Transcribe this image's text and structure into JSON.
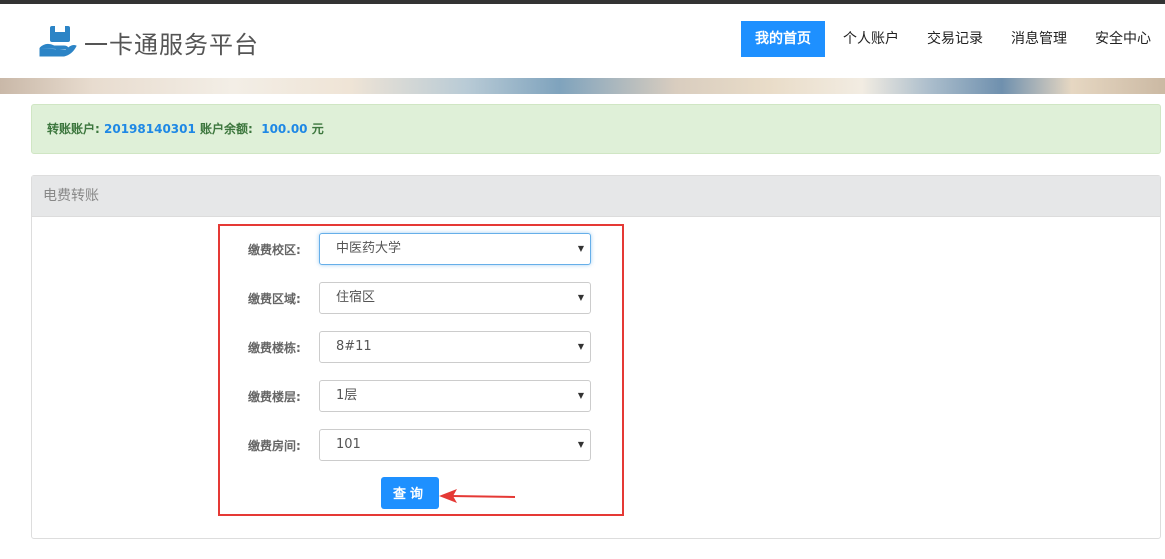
{
  "header": {
    "logo_text": "一卡通服务平台",
    "nav": [
      {
        "label": "我的首页",
        "active": true
      },
      {
        "label": "个人账户",
        "active": false
      },
      {
        "label": "交易记录",
        "active": false
      },
      {
        "label": "消息管理",
        "active": false
      },
      {
        "label": "安全中心",
        "active": false
      }
    ]
  },
  "alert": {
    "account_label": "转账账户:",
    "account_value": "20198140301",
    "balance_label": "账户余额:",
    "balance_value": "100.00",
    "balance_unit": "元"
  },
  "panel": {
    "title": "电费转账",
    "fields": [
      {
        "label": "缴费校区:",
        "value": "中医药大学"
      },
      {
        "label": "缴费区域:",
        "value": "住宿区"
      },
      {
        "label": "缴费楼栋:",
        "value": "8#11"
      },
      {
        "label": "缴费楼层:",
        "value": "1层"
      },
      {
        "label": "缴费房间:",
        "value": "101"
      }
    ],
    "query_label": "查询"
  },
  "colors": {
    "primary": "#1e90ff",
    "alert_bg": "#dff0d8",
    "highlight_border": "#e53935"
  }
}
